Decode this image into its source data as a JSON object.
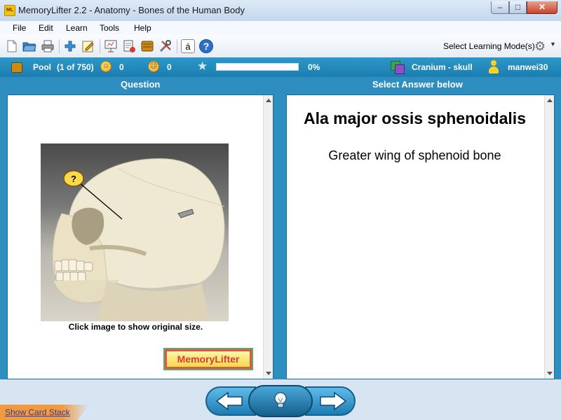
{
  "window": {
    "title": "MemoryLifter 2.2 - Anatomy - Bones of the Human Body",
    "app_icon": "ML",
    "controls": [
      "minimize-icon",
      "maximize-icon",
      "close-icon"
    ]
  },
  "menu": {
    "items": [
      "File",
      "Edit",
      "Learn",
      "Tools",
      "Help"
    ]
  },
  "toolbar": {
    "icons": [
      "new-document-icon",
      "open-folder-icon",
      "print-icon",
      "add-card-icon",
      "edit-card-icon",
      "presentation-icon",
      "print-cards-icon",
      "box-icon",
      "settings-tools-icon",
      "special-character-icon",
      "help-icon"
    ],
    "special_char_glyph": "á",
    "help_glyph": "?",
    "learning_mode_label": "Select Learning Mode(s)"
  },
  "status": {
    "pool_label": "Pool",
    "pool_count": "(1 of 750)",
    "right_count": "0",
    "wrong_count": "0",
    "progress_percent": 0,
    "progress_text": "0%",
    "chapter": "Cranium - skull",
    "user": "manwei30"
  },
  "question": {
    "header": "Question",
    "image_caption": "Click image to show original size.",
    "marker_glyph": "?",
    "logo_text": "MemoryLifter"
  },
  "answer": {
    "header": "Select Answer below",
    "title": "Ala major ossis sphenoidalis",
    "text": "Greater wing of sphenoid bone"
  },
  "footer": {
    "show_card_stack": "Show Card Stack"
  },
  "colors": {
    "accent": "#1b7db0",
    "status_bar": "#2d98c8",
    "show_card_stack": "#f39a3c"
  }
}
